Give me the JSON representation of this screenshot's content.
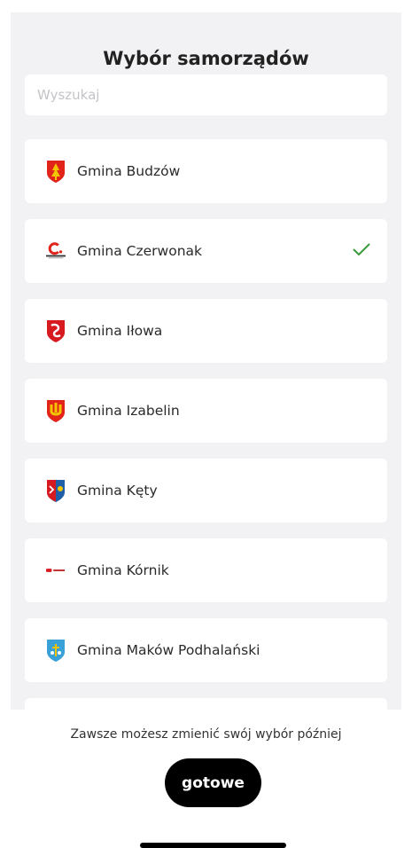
{
  "header": {
    "title": "Wybór samorządów"
  },
  "search": {
    "placeholder": "Wyszukaj"
  },
  "municipalities": [
    {
      "label": "Gmina Budzów",
      "icon": "budzow-crest-icon",
      "selected": false
    },
    {
      "label": "Gmina Czerwonak",
      "icon": "czerwonak-logo-icon",
      "selected": true
    },
    {
      "label": "Gmina Iłowa",
      "icon": "ilowa-crest-icon",
      "selected": false
    },
    {
      "label": "Gmina Izabelin",
      "icon": "izabelin-crest-icon",
      "selected": false
    },
    {
      "label": "Gmina Kęty",
      "icon": "kety-crest-icon",
      "selected": false
    },
    {
      "label": "Gmina Kórnik",
      "icon": "kornik-logo-icon",
      "selected": false
    },
    {
      "label": "Gmina Maków Podhalański",
      "icon": "makow-crest-icon",
      "selected": false
    }
  ],
  "footer": {
    "hint": "Zawsze możesz zmienić swój wybór później",
    "done_label": "gotowe"
  },
  "colors": {
    "sheet_background": "#f2f2f4",
    "card_background": "#ffffff",
    "check": "#3a9a3a",
    "button": "#000000"
  }
}
